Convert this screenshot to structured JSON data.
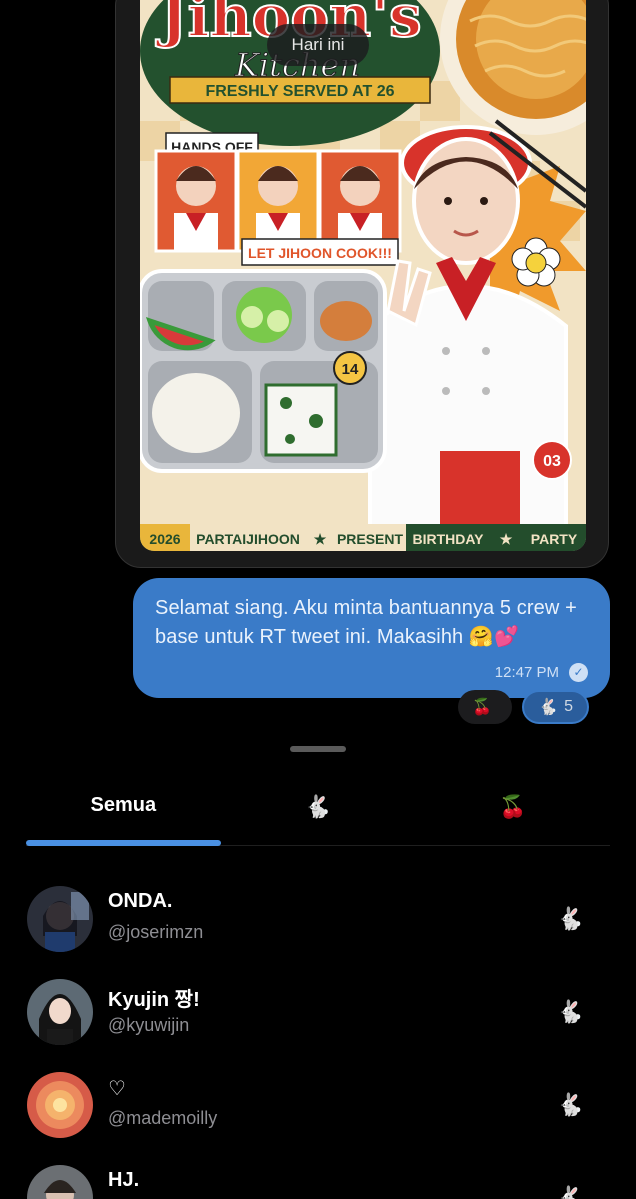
{
  "chat": {
    "date_label": "Hari ini",
    "poster": {
      "title_top": "Jihoon's",
      "title_script": "Kitchen",
      "ribbon": "FRESHLY SERVED AT 26",
      "sticker_hands_off": "HANDS OFF",
      "sticker_let_cook": "LET JIHOON COOK!!!",
      "badge_14": "14",
      "badge_03": "03",
      "footer_year": "2026",
      "footer_left": "PARTAIJIHOON",
      "footer_star1": "★",
      "footer_present": "PRESENT",
      "footer_birthday": "BIRTHDAY",
      "footer_star2": "★",
      "footer_party": "PARTY"
    },
    "message": {
      "text": "Selamat siang. Aku minta bantuannya 5 crew + base untuk RT tweet ini. Makasihh 🤗💕",
      "time": "12:47 PM",
      "status_icon": "✓"
    },
    "reactions": [
      {
        "emoji": "🍒",
        "count": ""
      },
      {
        "emoji": "🐇",
        "count": "5"
      }
    ]
  },
  "sheet": {
    "tabs": [
      {
        "label": "Semua"
      },
      {
        "label": "🐇"
      },
      {
        "label": "🍒"
      }
    ],
    "users": [
      {
        "name": "ONDA.",
        "handle": "@joserimzn",
        "reaction": "🐇"
      },
      {
        "name": "Kyujin 짱!",
        "handle": "@kyuwijin",
        "reaction": "🐇"
      },
      {
        "name": "♡",
        "handle": "@mademoilly",
        "reaction": "🐇"
      },
      {
        "name": "HJ.",
        "handle": "",
        "reaction": "🐇"
      }
    ]
  },
  "colors": {
    "bubble": "#3a7bc8",
    "tab_indicator": "#4a90e2",
    "background": "#000000"
  }
}
